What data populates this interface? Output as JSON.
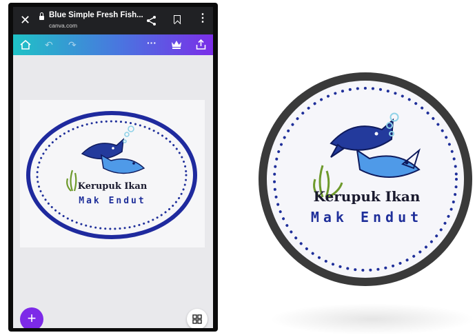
{
  "browser": {
    "title": "Blue Simple Fresh Fish...",
    "url": "canva.com",
    "close_icon": "close-icon",
    "share_icon": "share-icon",
    "bookmark_icon": "bookmark-icon",
    "menu_icon": "more-vertical-icon"
  },
  "toolbar": {
    "gradient": [
      "#1fc2c6",
      "#4b73e0",
      "#7b2ee8"
    ],
    "icons": [
      "home-icon",
      "undo-icon",
      "redo-icon",
      "more-horizontal-icon",
      "crown-icon",
      "share-upload-icon"
    ]
  },
  "design": {
    "brand_line1": "Kerupuk Ikan",
    "brand_line2": "Mak Endut",
    "colors": {
      "ring": "#1f2a9e",
      "dots": "#1f2f9a",
      "fish_dark": "#233a9c",
      "fish_light": "#4f9ae8",
      "seaweed": "#6e9a2c",
      "bubbles": "#8fd2e8"
    }
  },
  "fab": {
    "label": "+",
    "color": "#7d2ae8"
  },
  "pages_button": {
    "icon": "grid-icon"
  }
}
